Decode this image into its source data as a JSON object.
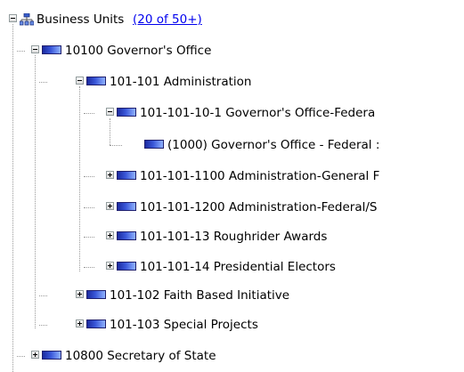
{
  "tree": {
    "root": {
      "label": "Business Units",
      "count_link": "(20 of 50+)",
      "icon": "org-chart-icon"
    },
    "nodes": [
      {
        "label": "10100 Governor's Office",
        "state": "expanded",
        "icon": "business-unit-icon"
      },
      {
        "label": "101-101 Administration",
        "state": "expanded",
        "icon": "business-unit-icon"
      },
      {
        "label": "101-101-10-1 Governor's Office-Federa",
        "state": "expanded",
        "icon": "business-unit-icon"
      },
      {
        "label": "(1000) Governor's Office - Federal :",
        "state": "leaf",
        "icon": "business-unit-icon"
      },
      {
        "label": "101-101-1100 Administration-General F",
        "state": "collapsed",
        "icon": "business-unit-icon"
      },
      {
        "label": "101-101-1200 Administration-Federal/S",
        "state": "collapsed",
        "icon": "business-unit-icon"
      },
      {
        "label": "101-101-13 Roughrider Awards",
        "state": "collapsed",
        "icon": "business-unit-icon"
      },
      {
        "label": "101-101-14 Presidential Electors",
        "state": "collapsed",
        "icon": "business-unit-icon"
      },
      {
        "label": "101-102 Faith Based Initiative",
        "state": "collapsed",
        "icon": "business-unit-icon"
      },
      {
        "label": "101-103 Special Projects",
        "state": "collapsed",
        "icon": "business-unit-icon"
      },
      {
        "label": "10800 Secretary of State",
        "state": "collapsed",
        "icon": "business-unit-icon"
      }
    ]
  }
}
